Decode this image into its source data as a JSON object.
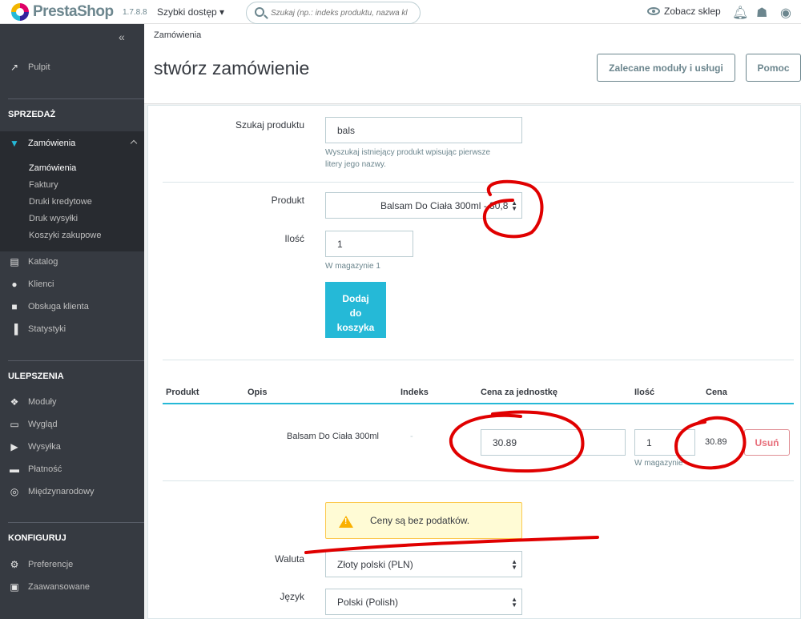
{
  "topbar": {
    "brand": "PrestaShop",
    "version": "1.7.8.8",
    "quick_access": "Szybki dostęp ▾",
    "search_placeholder": "Szukaj (np.: indeks produktu, nazwa kl",
    "view_shop": "Zobacz sklep"
  },
  "sidebar": {
    "dashboard": "Pulpit",
    "sections": {
      "sell": "SPRZEDAŻ",
      "improve": "ULEPSZENIA",
      "configure": "KONFIGURUJ"
    },
    "orders": "Zamówienia",
    "orders_sub": [
      "Zamówienia",
      "Faktury",
      "Druki kredytowe",
      "Druk wysyłki",
      "Koszyki zakupowe"
    ],
    "sell_items": [
      "Katalog",
      "Klienci",
      "Obsługa klienta",
      "Statystyki"
    ],
    "improve_items": [
      "Moduły",
      "Wygląd",
      "Wysyłka",
      "Płatność",
      "Międzynarodowy"
    ],
    "configure_items": [
      "Preferencje",
      "Zaawansowane"
    ]
  },
  "header": {
    "breadcrumb": "Zamówienia",
    "title": "stwórz zamówienie",
    "recommended_button": "Zalecane moduły i usługi",
    "help_button": "Pomoc"
  },
  "form": {
    "search_label": "Szukaj produktu",
    "search_value": "bals",
    "search_help": [
      "Wyszukaj istniejący produkt wpisując pierwsze",
      "litery jego nazwy."
    ],
    "product_label": "Produkt",
    "product_value": "Balsam Do Ciała 300ml - 30,8",
    "quantity_label": "Ilość",
    "quantity_value": "1",
    "stock_help": "W magazynie 1",
    "add_button_lines": [
      "Dodaj",
      "do",
      "koszyka"
    ]
  },
  "cart_table": {
    "headers": [
      "Produkt",
      "Opis",
      "Indeks",
      "Cena za jednostkę",
      "Ilość",
      "Cena"
    ],
    "row": {
      "description": "Balsam Do Ciała 300ml",
      "reference": "-",
      "unit_price": "30.89",
      "quantity": "1",
      "stock": "W magazynie",
      "price": "30.89",
      "remove": "Usuń"
    }
  },
  "alert": {
    "text": "Ceny są bez podatków."
  },
  "settings": {
    "currency_label": "Waluta",
    "currency_value": "Złoty polski (PLN)",
    "language_label": "Język",
    "language_value": "Polski (Polish)"
  },
  "colors": {
    "sidebar": "#363a41",
    "accent": "#25b9d7",
    "annotation": "#e00000"
  }
}
